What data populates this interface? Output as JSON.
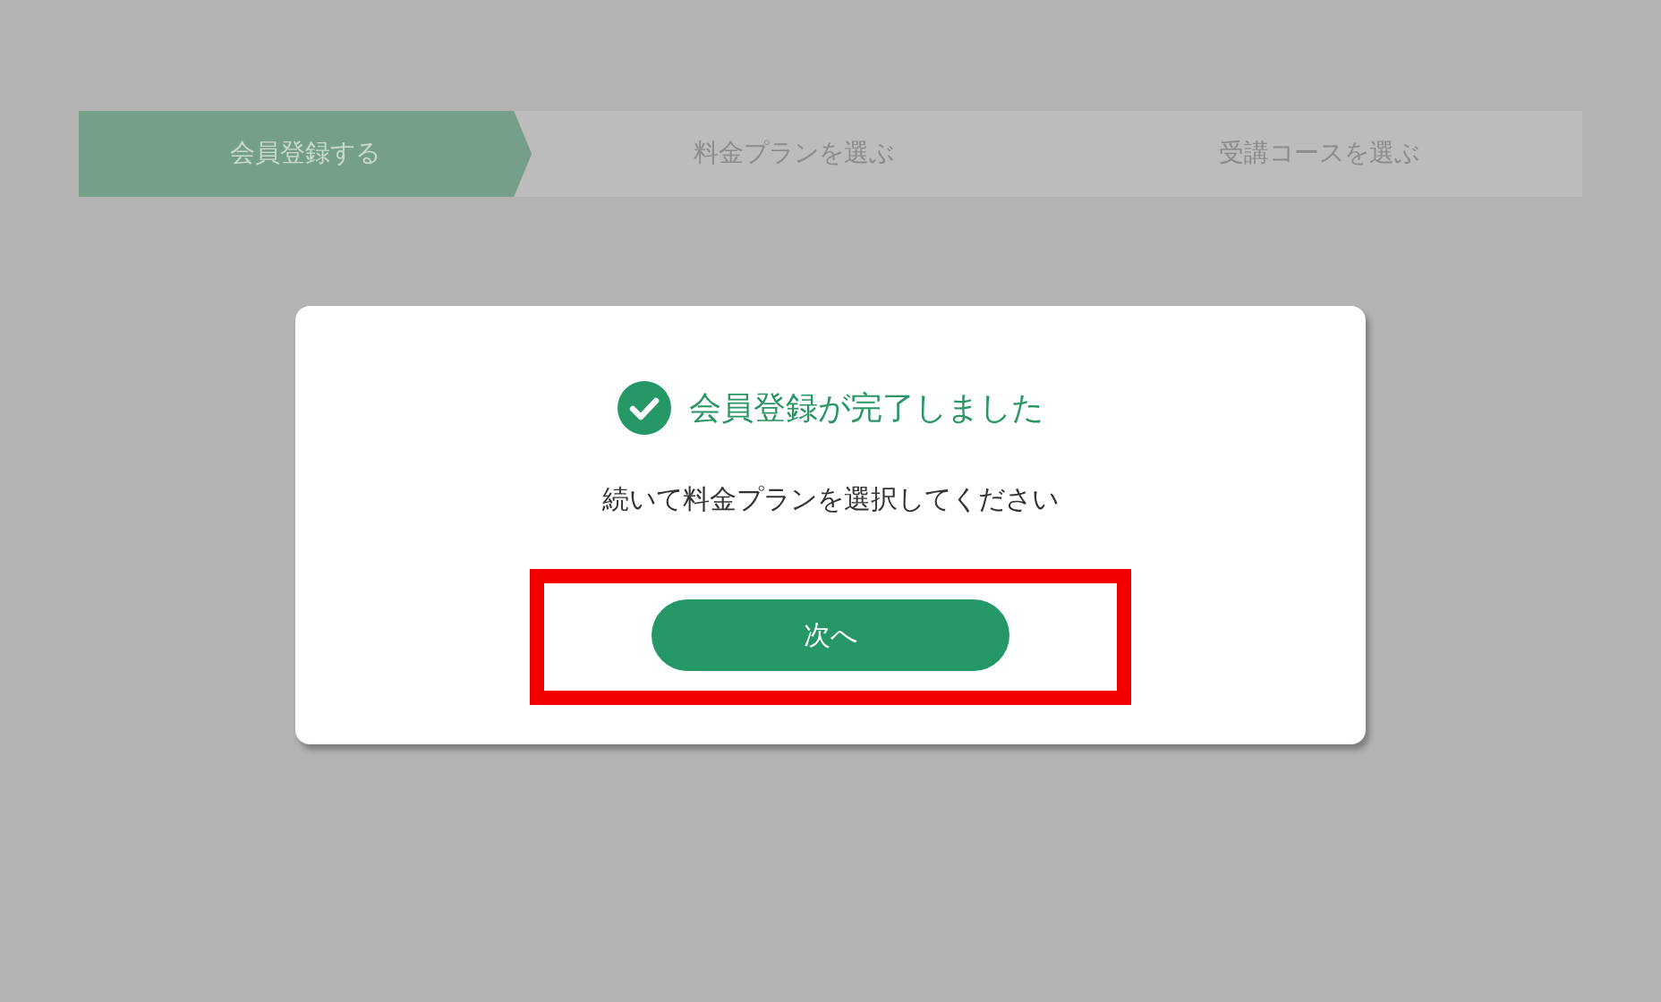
{
  "steps": [
    {
      "label": "会員登録する",
      "selected": true
    },
    {
      "label": "料金プランを選ぶ",
      "selected": false
    },
    {
      "label": "受講コースを選ぶ",
      "selected": false
    }
  ],
  "dialog": {
    "title": "会員登録が完了しました",
    "message": "続いて料金プランを選択してください",
    "button": "次へ",
    "highlighted": true
  }
}
